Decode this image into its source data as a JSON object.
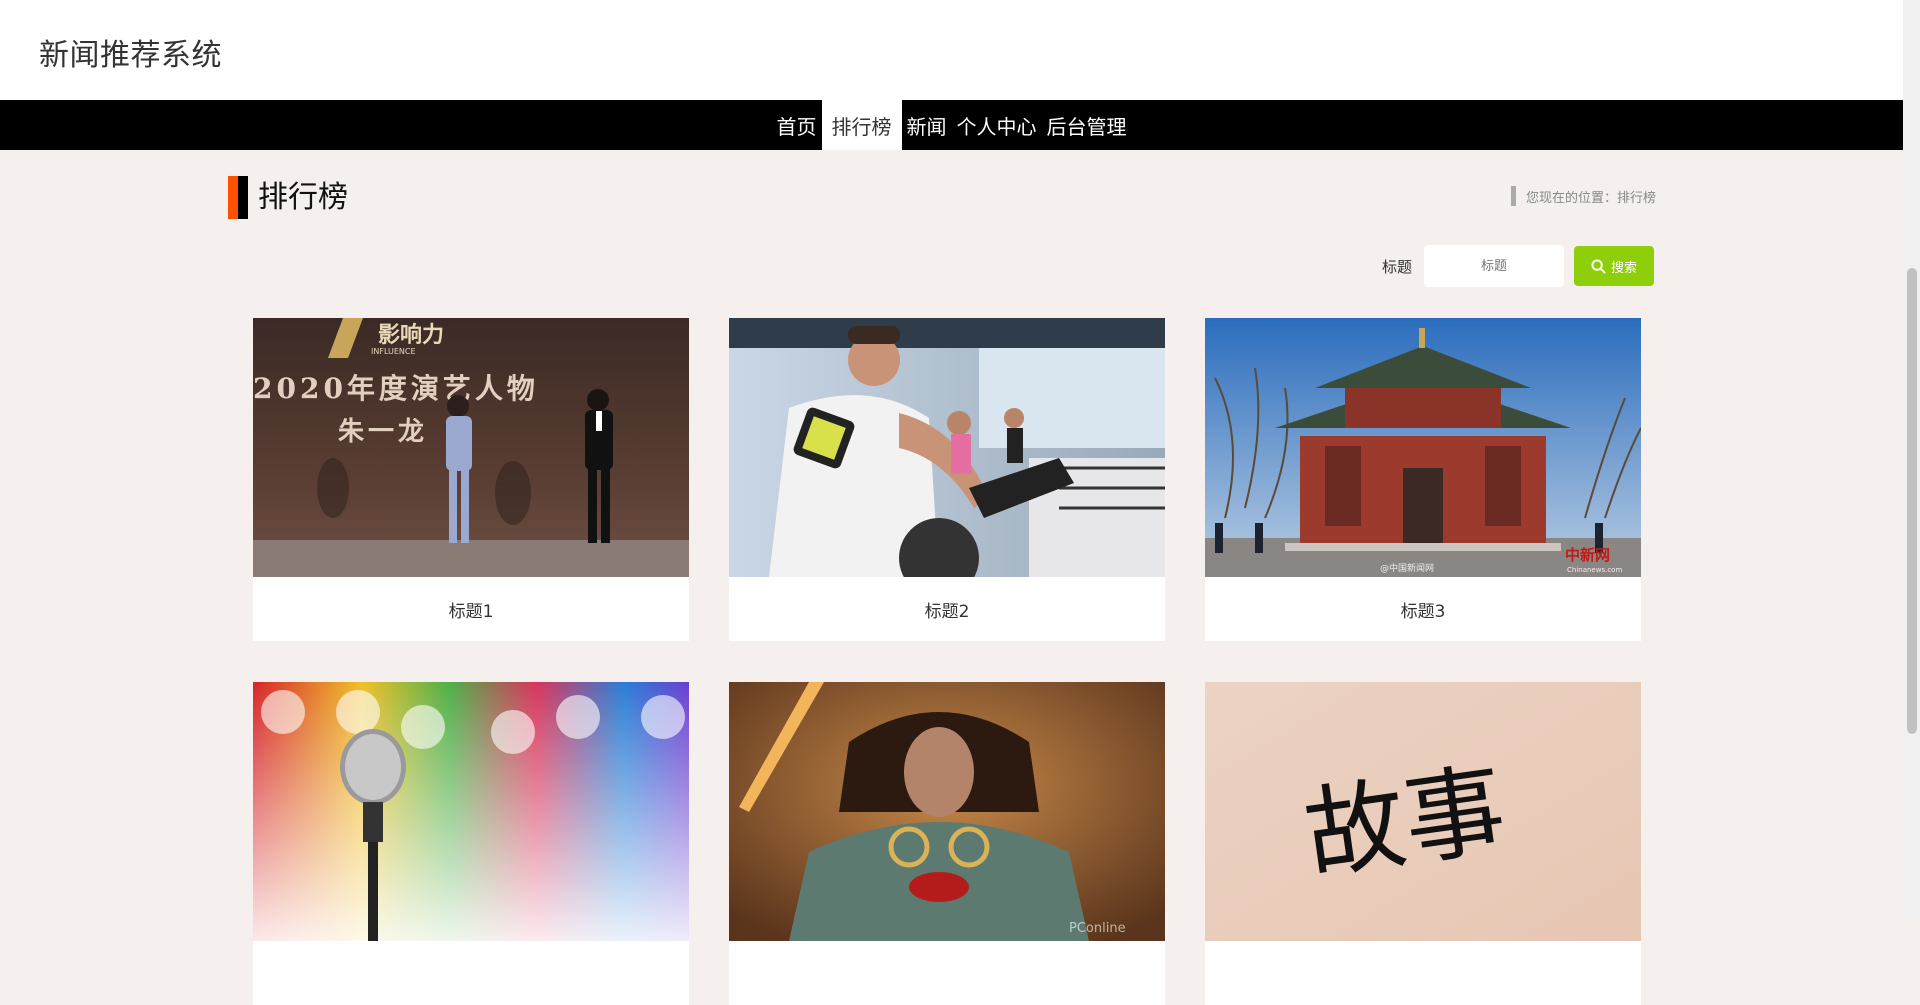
{
  "header": {
    "site_title": "新闻推荐系统"
  },
  "nav": {
    "items": [
      {
        "label": "首页",
        "active": false
      },
      {
        "label": "排行榜",
        "active": true
      },
      {
        "label": "新闻",
        "active": false
      },
      {
        "label": "个人中心",
        "active": false
      },
      {
        "label": "后台管理",
        "active": false
      }
    ]
  },
  "page": {
    "title": "排行榜",
    "breadcrumb": "您现在的位置：排行榜"
  },
  "search": {
    "label": "标题",
    "placeholder": "标题",
    "button_label": "搜索",
    "button_color": "#8fce0b"
  },
  "cards": [
    {
      "title": "标题1"
    },
    {
      "title": "标题2"
    },
    {
      "title": "标题3"
    },
    {
      "title": ""
    },
    {
      "title": ""
    },
    {
      "title": ""
    }
  ],
  "image_text": {
    "stage_logo": "影响力",
    "stage_logo_sub": "INFLUENCE",
    "stage_banner": "2020年度演艺人物",
    "stage_name": "朱一龙",
    "temple_watermark": "@中国新闻网",
    "temple_logo": "中新网",
    "temple_logo_url": "Chinanews.com",
    "movie_watermark": "PConline",
    "calligraphy": "故事"
  },
  "colors": {
    "accent": "#ff5000",
    "nav_bg": "#000000",
    "page_bg": "#f5f0ee"
  }
}
